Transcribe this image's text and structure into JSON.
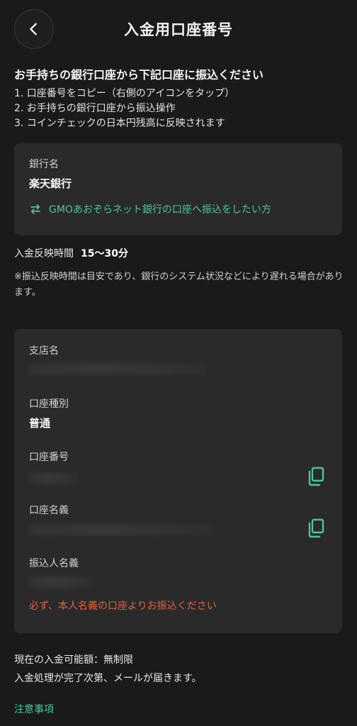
{
  "header": {
    "title": "入金用口座番号",
    "back_icon": "chevron-left-icon"
  },
  "instructions": {
    "lead": "お手持ちの銀行口座から下記口座に振込ください",
    "steps": [
      "1. 口座番号をコピー（右側のアイコンをタップ）",
      "2. お手持ちの銀行口座から振込操作",
      "3. コインチェックの日本円残高に反映されます"
    ]
  },
  "bank_card": {
    "bank_label": "銀行名",
    "bank_name": "楽天銀行",
    "gmo_link_icon": "swap-arrows-icon",
    "gmo_link_text": "GMOあおぞらネット銀行の口座へ振込をしたい方"
  },
  "reflection": {
    "label": "入金反映時間",
    "value": "15〜30分",
    "note": "※振込反映時間は目安であり、銀行のシステム状況などにより遅れる場合があります。"
  },
  "account_card": {
    "branch_label": "支店名",
    "type_label": "口座種別",
    "type_value": "普通",
    "number_label": "口座番号",
    "holder_label": "口座名義",
    "sender_label": "振込人名義",
    "copy_icon": "copy-icon",
    "warning": "必ず、本人名義の口座よりお振込ください"
  },
  "footer": {
    "limit": "現在の入金可能額：無制限",
    "mail_notice": "入金処理が完了次第、メールが届きます。",
    "notice_link": "注意事項"
  },
  "colors": {
    "background": "#1a1a1a",
    "card": "#2a2a2a",
    "accent": "#4cc49a",
    "warning": "#e0613f"
  }
}
